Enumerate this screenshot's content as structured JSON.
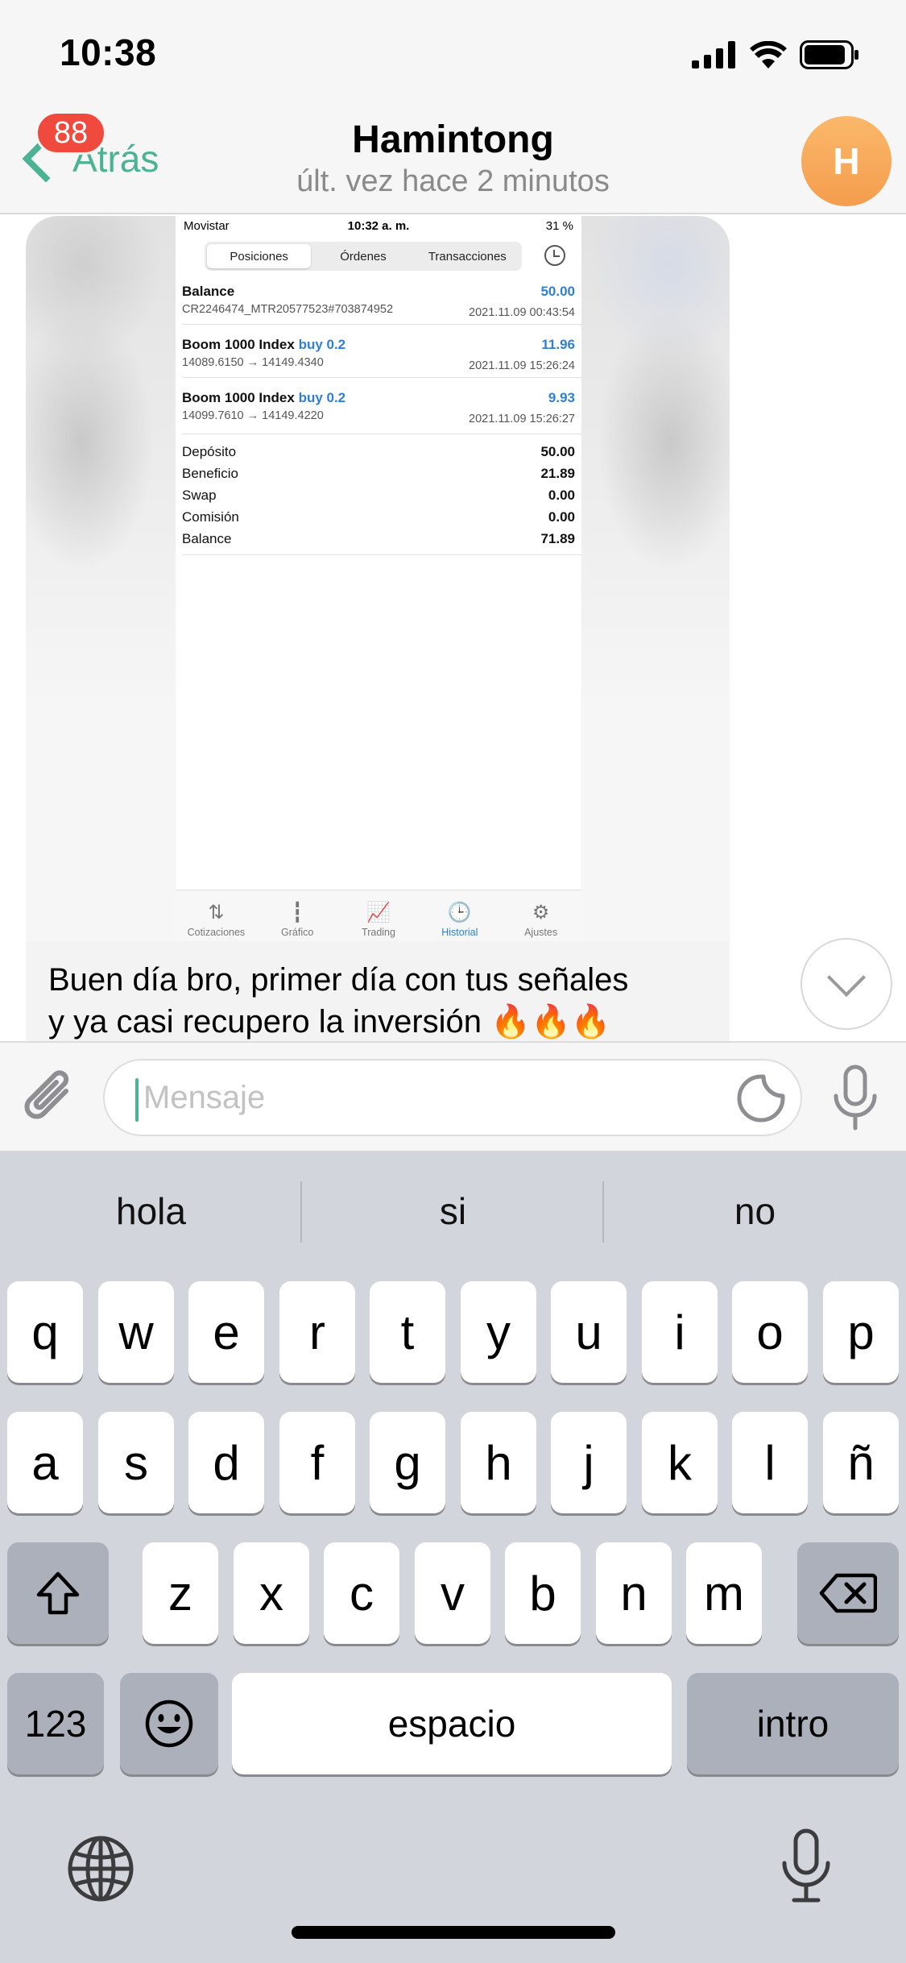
{
  "status_bar": {
    "time": "10:38",
    "icons": [
      "signal-icon",
      "wifi-icon",
      "battery-icon"
    ]
  },
  "header": {
    "back_label": "Atrás",
    "unread_badge": "88",
    "contact_name": "Hamintong",
    "last_seen": "últ. vez hace 2 minutos",
    "avatar_initial": "H"
  },
  "message": {
    "image": {
      "status": {
        "carrier": "Movistar",
        "time": "10:32 a. m.",
        "battery": "31 %"
      },
      "tabs": [
        "Posiciones",
        "Órdenes",
        "Transacciones"
      ],
      "active_tab": "Posiciones",
      "rows": [
        {
          "name": "Balance",
          "tag": "",
          "value": "50.00",
          "detail": "CR2246474_MTR20577523#703874952",
          "date": "2021.11.09 00:43:54"
        },
        {
          "name": "Boom 1000 Index",
          "tag": "buy 0.2",
          "value": "11.96",
          "detail": "14089.6150 → 14149.4340",
          "date": "2021.11.09 15:26:24"
        },
        {
          "name": "Boom 1000 Index",
          "tag": "buy 0.2",
          "value": "9.93",
          "detail": "14099.7610 → 14149.4220",
          "date": "2021.11.09 15:26:27"
        }
      ],
      "summary": [
        {
          "label": "Depósito",
          "value": "50.00"
        },
        {
          "label": "Beneficio",
          "value": "21.89"
        },
        {
          "label": "Swap",
          "value": "0.00"
        },
        {
          "label": "Comisión",
          "value": "0.00"
        },
        {
          "label": "Balance",
          "value": "71.89"
        }
      ],
      "nav": [
        {
          "label": "Cotizaciones",
          "glyph": "⇅"
        },
        {
          "label": "Gráfico",
          "glyph": "┇"
        },
        {
          "label": "Trading",
          "glyph": "📈"
        },
        {
          "label": "Historial",
          "glyph": "🕒"
        },
        {
          "label": "Ajustes",
          "glyph": "⚙"
        }
      ],
      "active_nav": "Historial"
    },
    "text_line1": "Buen día bro, primer día con tus señales",
    "text_line2": "y ya casi recupero la inversión 🔥🔥🔥"
  },
  "input": {
    "placeholder": "Mensaje"
  },
  "keyboard": {
    "suggestions": [
      "hola",
      "si",
      "no"
    ],
    "row1": [
      "q",
      "w",
      "e",
      "r",
      "t",
      "y",
      "u",
      "i",
      "o",
      "p"
    ],
    "row2": [
      "a",
      "s",
      "d",
      "f",
      "g",
      "h",
      "j",
      "k",
      "l",
      "ñ"
    ],
    "row3": [
      "z",
      "x",
      "c",
      "v",
      "b",
      "n",
      "m"
    ],
    "numbers_key": "123",
    "space_key": "espacio",
    "return_key": "intro"
  },
  "colors": {
    "accent": "#4bb394",
    "badge": "#ef4a3d",
    "avatar": "#f6a656",
    "link_blue": "#2f7fd4"
  }
}
